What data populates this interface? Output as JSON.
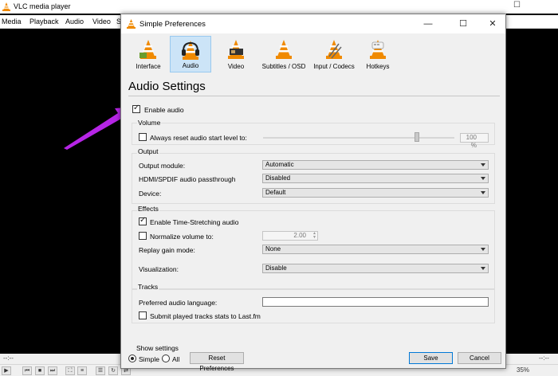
{
  "main_window": {
    "title": "VLC media player",
    "menu": [
      "Media",
      "Playback",
      "Audio",
      "Video",
      "S"
    ],
    "time_left": "--:--",
    "time_right": "--:--",
    "volume": "35%"
  },
  "dialog": {
    "title": "Simple Preferences",
    "categories": [
      {
        "label": "Interface",
        "icon": "interface-icon"
      },
      {
        "label": "Audio",
        "icon": "audio-icon",
        "selected": true
      },
      {
        "label": "Video",
        "icon": "video-icon"
      },
      {
        "label": "Subtitles / OSD",
        "icon": "subtitles-icon"
      },
      {
        "label": "Input / Codecs",
        "icon": "codecs-icon"
      },
      {
        "label": "Hotkeys",
        "icon": "hotkeys-icon"
      }
    ],
    "section_title": "Audio Settings",
    "enable_audio": {
      "label": "Enable audio",
      "checked": true
    },
    "volume": {
      "title": "Volume",
      "reset_label": "Always reset audio start level to:",
      "reset_checked": false,
      "level": "100 %",
      "level_value": 100
    },
    "output": {
      "title": "Output",
      "module_label": "Output module:",
      "module_value": "Automatic",
      "hdmi_label": "HDMI/SPDIF audio passthrough",
      "hdmi_value": "Disabled",
      "device_label": "Device:",
      "device_value": "Default"
    },
    "effects": {
      "title": "Effects",
      "time_stretch_label": "Enable Time-Stretching audio",
      "time_stretch_checked": true,
      "normalize_label": "Normalize volume to:",
      "normalize_checked": false,
      "normalize_value": "2.00",
      "replay_gain_label": "Replay gain mode:",
      "replay_gain_value": "None",
      "visualization_label": "Visualization:",
      "visualization_value": "Disable"
    },
    "tracks": {
      "title": "Tracks",
      "language_label": "Preferred audio language:",
      "language_value": "",
      "lastfm_label": "Submit played tracks stats to Last.fm",
      "lastfm_checked": false
    },
    "footer": {
      "show_settings": "Show settings",
      "simple": "Simple",
      "all": "All",
      "reset": "Reset Preferences",
      "save": "Save",
      "cancel": "Cancel"
    }
  },
  "colors": {
    "accent": "#0078d7",
    "annotation_arrow": "#b625e6",
    "vlc_orange": "#f08a00"
  }
}
